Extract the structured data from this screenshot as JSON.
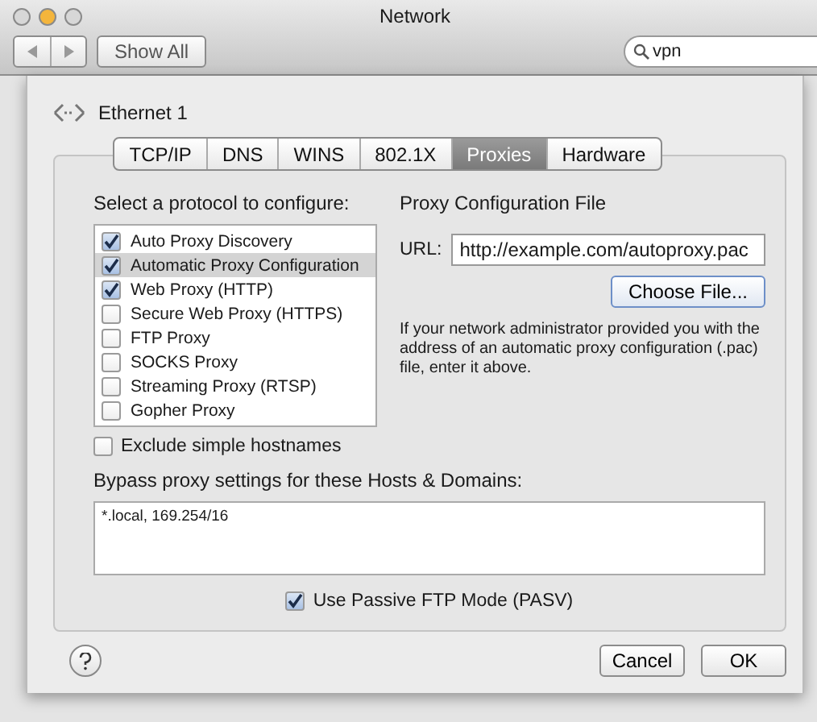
{
  "window": {
    "title": "Network"
  },
  "toolbar": {
    "show_all": "Show All",
    "search": {
      "value": "vpn"
    }
  },
  "interface": {
    "name": "Ethernet 1"
  },
  "tabs": [
    {
      "label": "TCP/IP",
      "selected": false
    },
    {
      "label": "DNS",
      "selected": false
    },
    {
      "label": "WINS",
      "selected": false
    },
    {
      "label": "802.1X",
      "selected": false
    },
    {
      "label": "Proxies",
      "selected": true
    },
    {
      "label": "Hardware",
      "selected": false
    }
  ],
  "protocols": {
    "heading": "Select a protocol to configure:",
    "items": [
      {
        "label": "Auto Proxy Discovery",
        "checked": true,
        "selected": false
      },
      {
        "label": "Automatic Proxy Configuration",
        "checked": true,
        "selected": true
      },
      {
        "label": "Web Proxy (HTTP)",
        "checked": true,
        "selected": false
      },
      {
        "label": "Secure Web Proxy (HTTPS)",
        "checked": false,
        "selected": false
      },
      {
        "label": "FTP Proxy",
        "checked": false,
        "selected": false
      },
      {
        "label": "SOCKS Proxy",
        "checked": false,
        "selected": false
      },
      {
        "label": "Streaming Proxy (RTSP)",
        "checked": false,
        "selected": false
      },
      {
        "label": "Gopher Proxy",
        "checked": false,
        "selected": false
      }
    ]
  },
  "config": {
    "heading": "Proxy Configuration File",
    "url_label": "URL:",
    "url": "http://example.com/autoproxy.pac",
    "choose": "Choose File...",
    "help": "If your network administrator provided you with the address of an automatic proxy configuration (.pac) file, enter it above."
  },
  "exclude_simple": {
    "label": "Exclude simple hostnames",
    "checked": false
  },
  "bypass": {
    "label": "Bypass proxy settings for these Hosts & Domains:",
    "value": "*.local, 169.254/16"
  },
  "passive_ftp": {
    "label": "Use Passive FTP Mode (PASV)",
    "checked": true
  },
  "buttons": {
    "cancel": "Cancel",
    "ok": "OK"
  }
}
